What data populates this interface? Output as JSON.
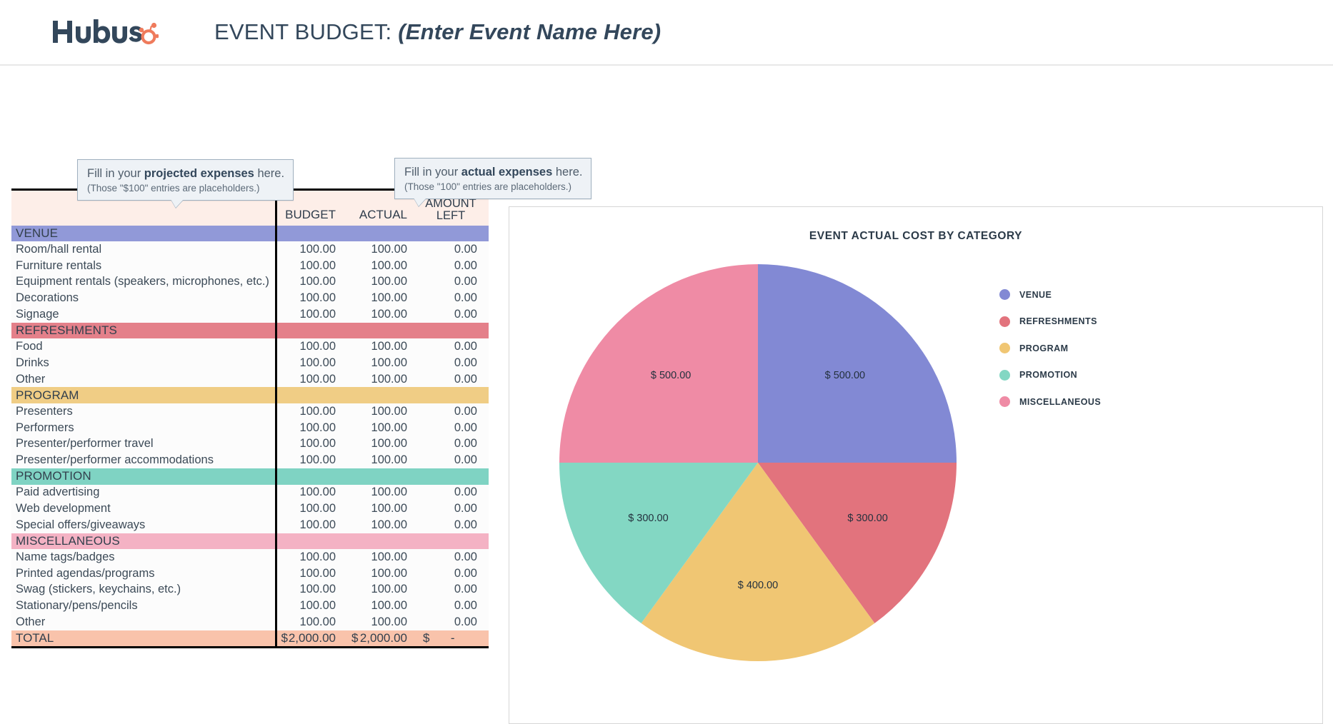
{
  "header": {
    "logo_name": "hubspot-logo",
    "title_prefix": "EVENT BUDGET:",
    "event_name": "(Enter Event Name Here)"
  },
  "callouts": [
    {
      "id": "budget",
      "line1_pre": "Fill in your ",
      "line1_bold": "projected expenses",
      "line1_post": " here.",
      "line2": "(Those \"$100\" entries are placeholders.)"
    },
    {
      "id": "actual",
      "line1_pre": "Fill in your ",
      "line1_bold": "actual expenses",
      "line1_post": " here.",
      "line2": "(Those \"100\" entries are placeholders.)"
    }
  ],
  "table": {
    "headers": {
      "item": "",
      "budget": "BUDGET",
      "actual": "ACTUAL",
      "amount_left_l1": "AMOUNT",
      "amount_left_l2": "LEFT"
    },
    "sections": [
      {
        "name": "VENUE",
        "color": "#9199d8",
        "rows": [
          {
            "item": "Room/hall rental",
            "budget": "100.00",
            "actual": "100.00",
            "left": "0.00"
          },
          {
            "item": "Furniture rentals",
            "budget": "100.00",
            "actual": "100.00",
            "left": "0.00"
          },
          {
            "item": "Equipment rentals (speakers, microphones, etc.)",
            "budget": "100.00",
            "actual": "100.00",
            "left": "0.00"
          },
          {
            "item": "Decorations",
            "budget": "100.00",
            "actual": "100.00",
            "left": "0.00"
          },
          {
            "item": "Signage",
            "budget": "100.00",
            "actual": "100.00",
            "left": "0.00"
          }
        ]
      },
      {
        "name": "REFRESHMENTS",
        "color": "#e4808a",
        "rows": [
          {
            "item": "Food",
            "budget": "100.00",
            "actual": "100.00",
            "left": "0.00"
          },
          {
            "item": "Drinks",
            "budget": "100.00",
            "actual": "100.00",
            "left": "0.00"
          },
          {
            "item": "Other",
            "budget": "100.00",
            "actual": "100.00",
            "left": "0.00"
          }
        ]
      },
      {
        "name": "PROGRAM",
        "color": "#f0cd85",
        "rows": [
          {
            "item": "Presenters",
            "budget": "100.00",
            "actual": "100.00",
            "left": "0.00"
          },
          {
            "item": "Performers",
            "budget": "100.00",
            "actual": "100.00",
            "left": "0.00"
          },
          {
            "item": "Presenter/performer travel",
            "budget": "100.00",
            "actual": "100.00",
            "left": "0.00"
          },
          {
            "item": "Presenter/performer accommodations",
            "budget": "100.00",
            "actual": "100.00",
            "left": "0.00"
          }
        ]
      },
      {
        "name": "PROMOTION",
        "color": "#7fd3c3",
        "rows": [
          {
            "item": "Paid advertising",
            "budget": "100.00",
            "actual": "100.00",
            "left": "0.00"
          },
          {
            "item": "Web development",
            "budget": "100.00",
            "actual": "100.00",
            "left": "0.00"
          },
          {
            "item": "Special offers/giveaways",
            "budget": "100.00",
            "actual": "100.00",
            "left": "0.00"
          }
        ]
      },
      {
        "name": "MISCELLANEOUS",
        "color": "#f4b2c4",
        "rows": [
          {
            "item": "Name tags/badges",
            "budget": "100.00",
            "actual": "100.00",
            "left": "0.00"
          },
          {
            "item": "Printed agendas/programs",
            "budget": "100.00",
            "actual": "100.00",
            "left": "0.00"
          },
          {
            "item": "Swag (stickers, keychains, etc.)",
            "budget": "100.00",
            "actual": "100.00",
            "left": "0.00"
          },
          {
            "item": "Stationary/pens/pencils",
            "budget": "100.00",
            "actual": "100.00",
            "left": "0.00"
          },
          {
            "item": "Other",
            "budget": "100.00",
            "actual": "100.00",
            "left": "0.00"
          }
        ]
      }
    ],
    "total": {
      "label": "TOTAL",
      "currency": "$",
      "budget": "2,000.00",
      "actual": "2,000.00",
      "left": "-"
    }
  },
  "chart_data": {
    "type": "pie",
    "title": "EVENT ACTUAL COST BY CATEGORY",
    "categories": [
      "VENUE",
      "REFRESHMENTS",
      "PROGRAM",
      "PROMOTION",
      "MISCELLANEOUS"
    ],
    "values": [
      500,
      300,
      400,
      300,
      500
    ],
    "labels": [
      "$ 500.00",
      "$ 300.00",
      "$ 400.00",
      "$ 300.00",
      "$ 500.00"
    ],
    "colors": [
      "#8289d4",
      "#e2737d",
      "#f0c673",
      "#83d7c3",
      "#ef8ba5"
    ],
    "total": 2000,
    "legend_position": "right",
    "start_angle_deg": -90,
    "direction": "clockwise",
    "xlabel": "",
    "ylabel": ""
  }
}
